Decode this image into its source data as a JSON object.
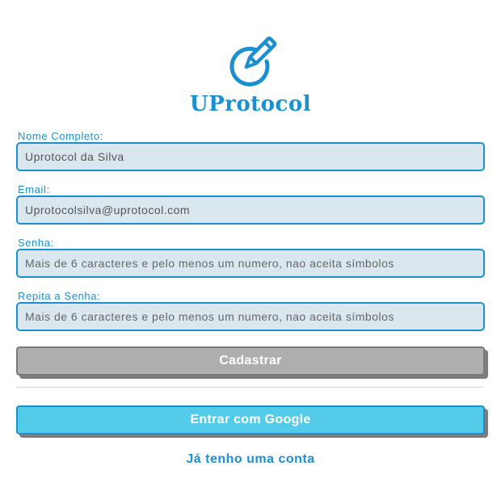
{
  "brand": {
    "name": "UProtocol",
    "logo_icon": "pencil-circle-icon",
    "color": "#1c8fd0"
  },
  "form": {
    "full_name": {
      "label": "Nome Completo:",
      "value": "Uprotocol da Silva",
      "placeholder": ""
    },
    "email": {
      "label": "Email:",
      "value": "Uprotocolsilva@uprotocol.com",
      "placeholder": ""
    },
    "password": {
      "label": "Senha:",
      "value": "",
      "placeholder": "Mais de 6 caracteres e pelo menos um numero, nao aceita símbolos"
    },
    "confirm_password": {
      "label": "Repita a Senha:",
      "value": "",
      "placeholder": "Mais de 6 caracteres e pelo menos um numero, nao aceita símbolos"
    }
  },
  "actions": {
    "register_label": "Cadastrar",
    "google_label": "Entrar com Google",
    "login_link": "Já tenho uma conta"
  },
  "colors": {
    "input_bg": "#dbe7ef",
    "register_bg": "#aeaeae",
    "google_bg": "#54cce9"
  }
}
